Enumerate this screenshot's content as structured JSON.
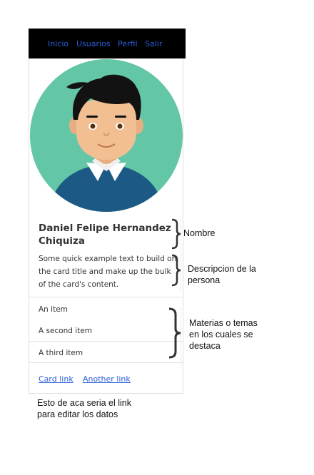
{
  "nav": {
    "items": [
      {
        "label": "Inicio"
      },
      {
        "label": "Usuarios"
      },
      {
        "label": "Perfil"
      },
      {
        "label": "Salir"
      }
    ]
  },
  "card": {
    "title": "Daniel Felipe Hernandez Chiquiza",
    "text": "Some quick example text to build on the card title and make up the bulk of the card's content.",
    "list_items": [
      "An item",
      "A second item",
      "A third item"
    ],
    "links": [
      "Card link",
      "Another link"
    ]
  },
  "annotations": {
    "name": "Nombre",
    "description": "Descripcion de la persona",
    "subjects": "Materias o temas en los cuales se destaca",
    "edit_link": "Esto de aca seria el link para editar los datos"
  },
  "colors": {
    "nav_bg": "#000000",
    "link": "#2b5fd9",
    "avatar_bg": "#63c6a6",
    "shirt": "#1c5a85",
    "skin": "#f2bf93",
    "hair": "#121212"
  }
}
